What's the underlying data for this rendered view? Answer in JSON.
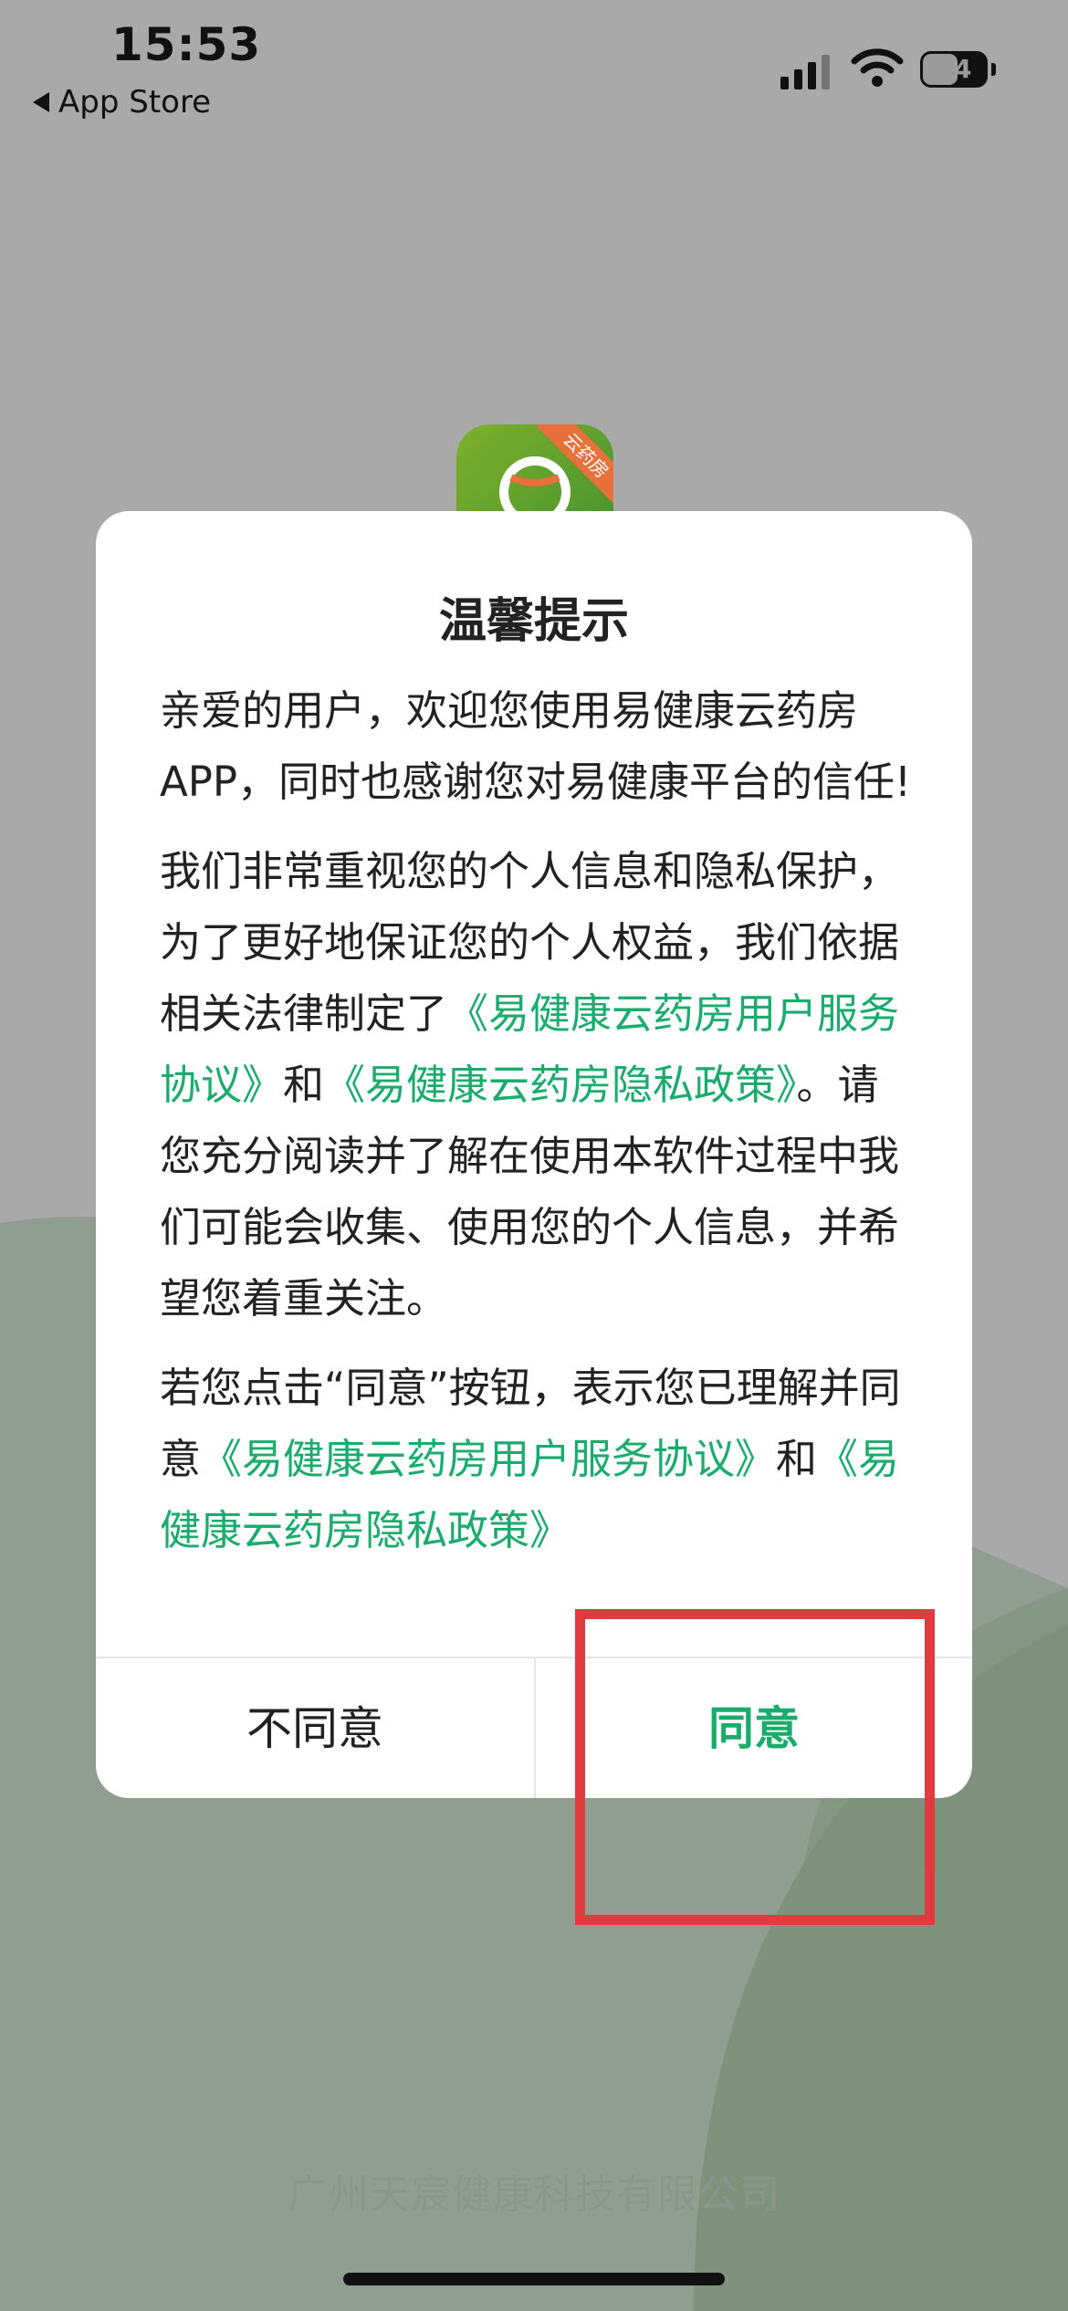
{
  "status_bar": {
    "time": "15:53",
    "back_label": "App Store",
    "battery": "34"
  },
  "app": {
    "logo_badge": "云药房"
  },
  "dialog": {
    "title": "温馨提示",
    "para1": "亲爱的用户，欢迎您使用易健康云药房APP，同时也感谢您对易健康平台的信任!",
    "para2_a": "我们非常重视您的个人信息和隐私保护，为了更好地保证您的个人权益，我们依据相关法律制定了",
    "para2_link1": "《易健康云药房用户服务协议》",
    "para2_b": "和",
    "para2_link2": "《易健康云药房隐私政策》",
    "para2_c": "。请您充分阅读并了解在使用本软件过程中我们可能会收集、使用您的个人信息，并希望您着重关注。",
    "para3_a": "若您点击“同意”按钮，表示您已理解并同意",
    "para3_link1": "《易健康云药房用户服务协议》",
    "para3_b": "和",
    "para3_link2": "《易健康云药房隐私政策》",
    "disagree_label": "不同意",
    "agree_label": "同意"
  },
  "footer": {
    "company": "广州天宸健康科技有限公司"
  },
  "colors": {
    "accent": "#1aab6d",
    "highlight": "#e03b3f"
  }
}
